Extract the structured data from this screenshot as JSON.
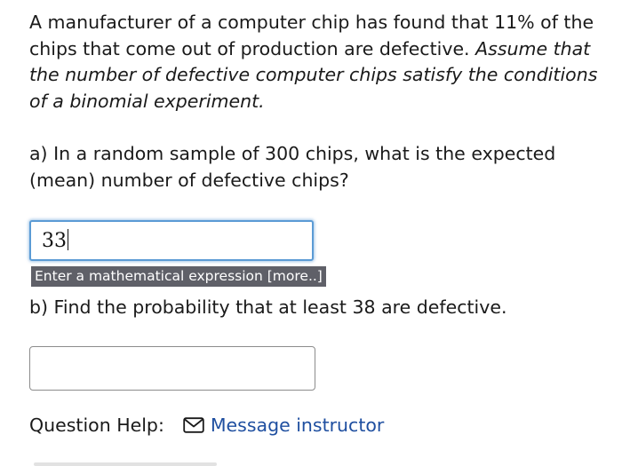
{
  "problem": {
    "statement": "A manufacturer of a computer chip has found that 11% of the chips that come out of production are defective.",
    "assumption": "Assume that the number of defective computer chips satisfy the conditions of a binomial experiment."
  },
  "part_a": {
    "question": "a) In a random sample of 300 chips, what is the expected (mean) number of defective chips?",
    "answer_value": "33",
    "hint": "Enter a mathematical expression [more..]"
  },
  "part_b": {
    "question": "b) Find the probability that at least 38 are defective.",
    "answer_value": ""
  },
  "help": {
    "label": "Question Help:",
    "message_link": "Message instructor",
    "message_icon": "envelope-icon",
    "link_color": "#1f4fa0"
  },
  "colors": {
    "focus_border": "#5b9bd5",
    "hint_background": "#5f6068",
    "text": "#1a1a1a"
  }
}
